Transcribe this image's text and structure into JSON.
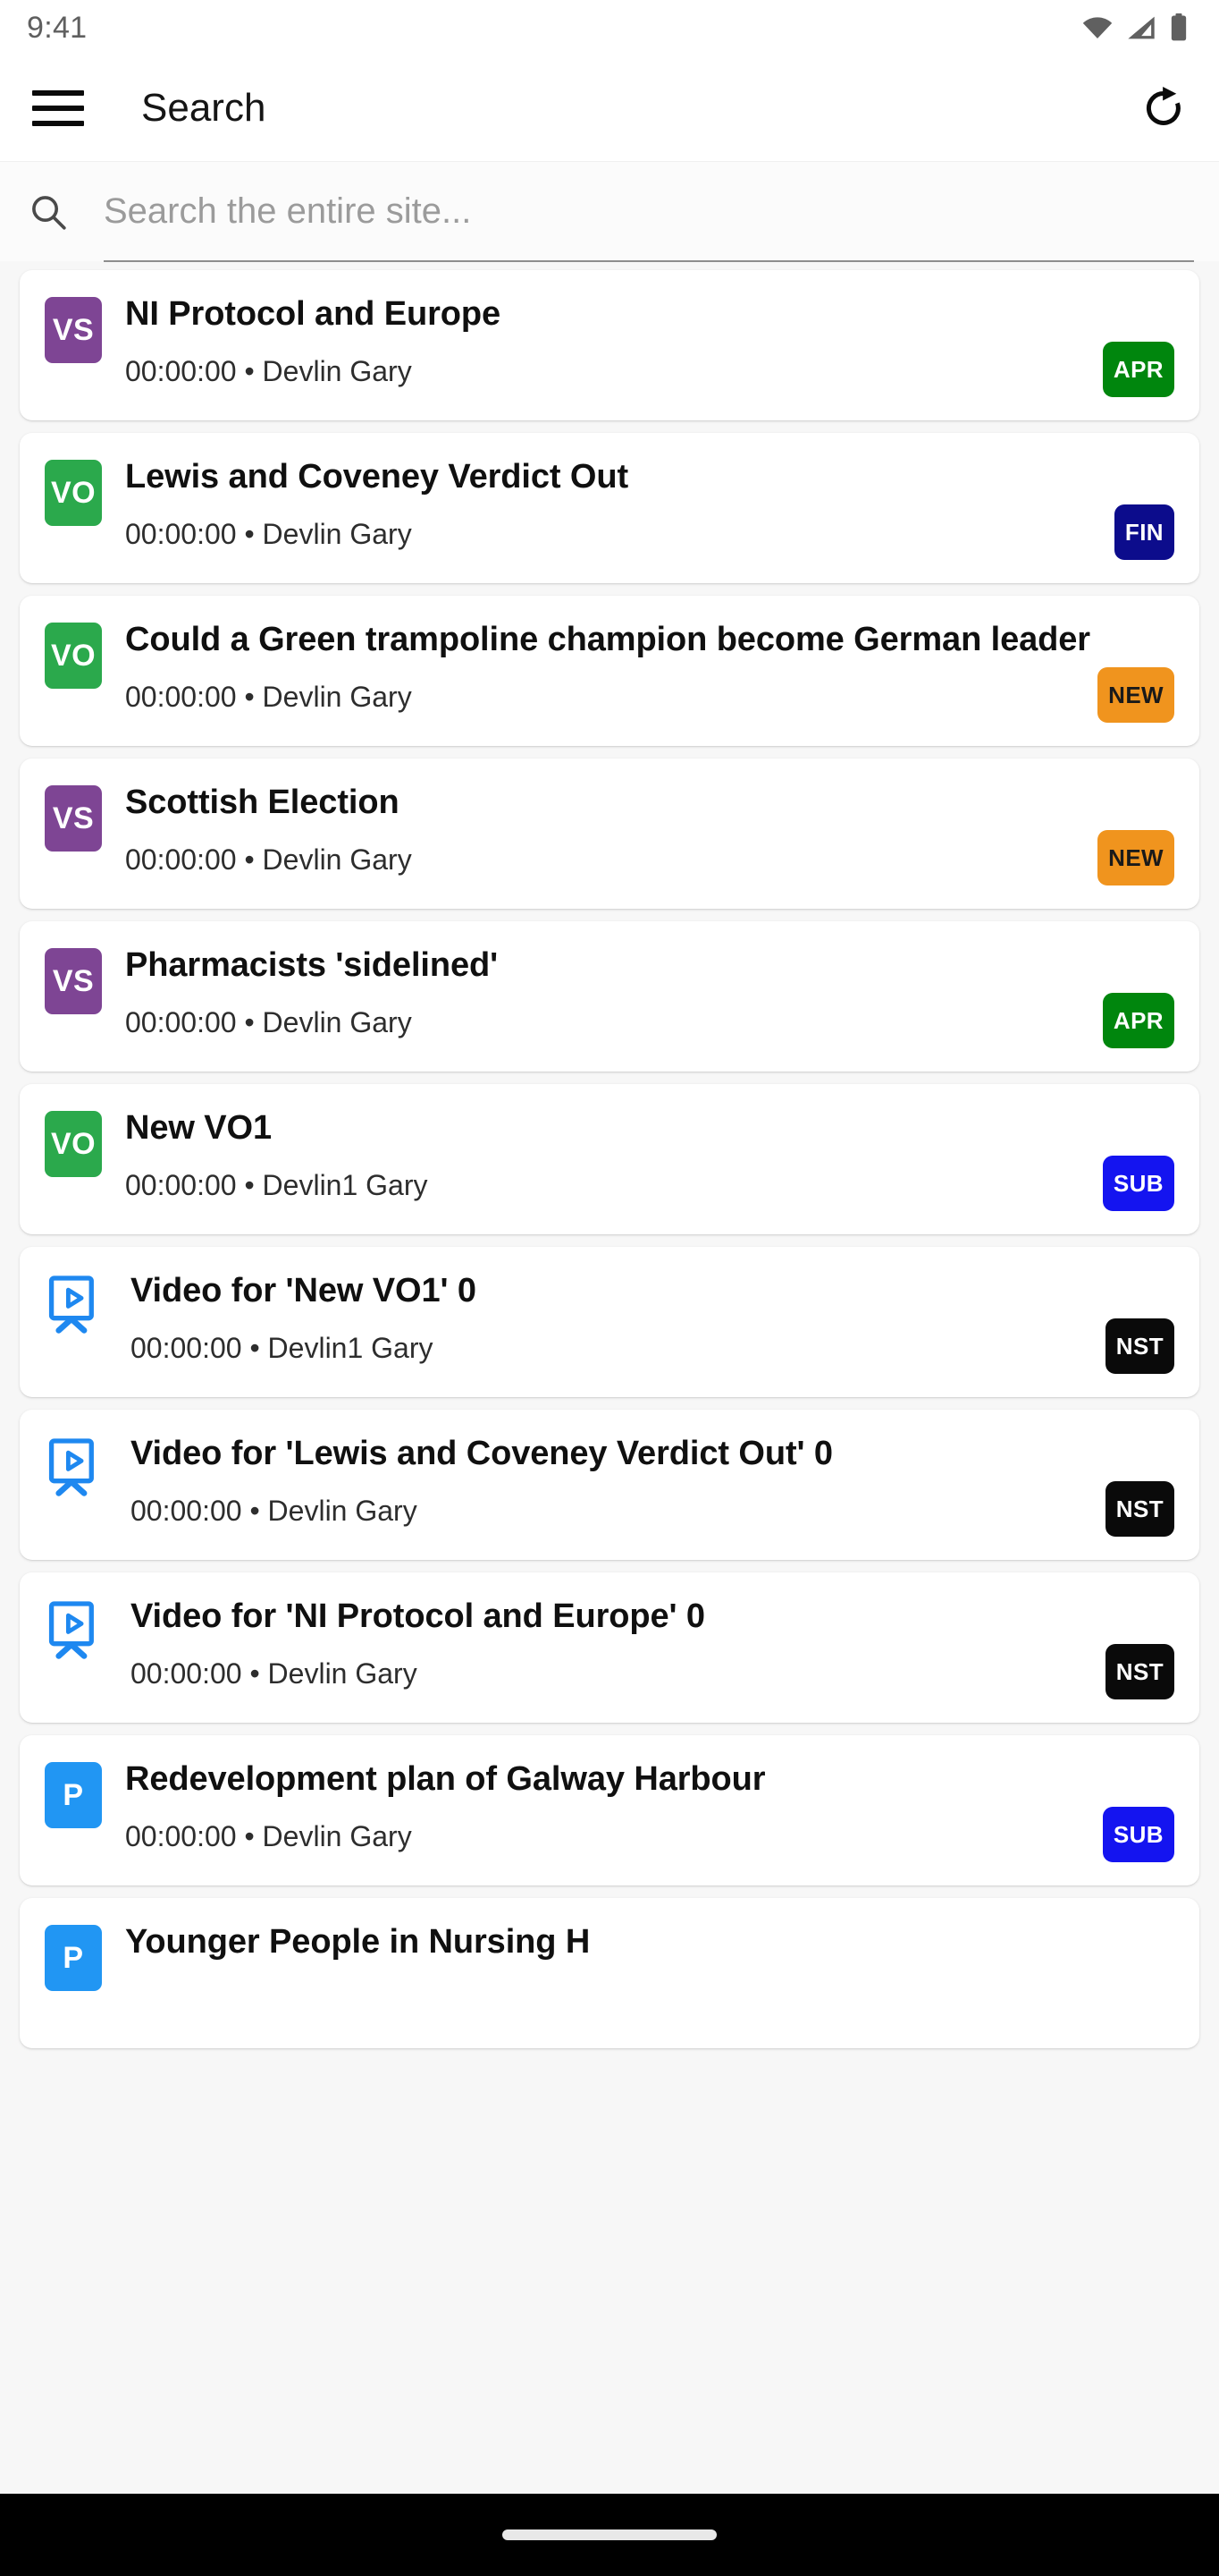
{
  "status_bar": {
    "time": "9:41",
    "icons": [
      "wifi-icon",
      "cellular-signal-icon",
      "battery-icon"
    ]
  },
  "app_bar": {
    "menu_icon": "hamburger-menu-icon",
    "title": "Search",
    "refresh_icon": "refresh-icon"
  },
  "search": {
    "icon": "search-icon",
    "value": "",
    "placeholder": "Search the entire site..."
  },
  "colors": {
    "type_vs": "#7E4594",
    "type_vo": "#2BA94C",
    "type_package": "#2196F3",
    "type_video": "#1E88F0",
    "badge_apr": "#00860D",
    "badge_fin": "#0C0C8C",
    "badge_new": "#F0941E",
    "badge_sub": "#1414F0",
    "badge_nst": "#0A0A0A",
    "badge_new_text": "#1A1A1A",
    "page_background": "#f7f7f7",
    "card_background": "#ffffff"
  },
  "results": [
    {
      "type_icon": "vs-icon",
      "type_label": "VS",
      "type_color": "#7E4594",
      "title": "NI Protocol and Europe",
      "meta": "00:00:00 • Devlin Gary",
      "badge": "APR",
      "badge_color": "#00860D",
      "badge_text_color": "#ffffff"
    },
    {
      "type_icon": "vo-icon",
      "type_label": "VO",
      "type_color": "#2BA94C",
      "title": "Lewis and Coveney Verdict Out",
      "meta": "00:00:00 • Devlin Gary",
      "badge": "FIN",
      "badge_color": "#0C0C8C",
      "badge_text_color": "#ffffff"
    },
    {
      "type_icon": "vo-icon",
      "type_label": "VO",
      "type_color": "#2BA94C",
      "title": "Could a Green trampoline champion become German leader",
      "meta": "00:00:00 • Devlin Gary",
      "badge": "NEW",
      "badge_color": "#F0941E",
      "badge_text_color": "#1A1A1A"
    },
    {
      "type_icon": "vs-icon",
      "type_label": "VS",
      "type_color": "#7E4594",
      "title": "Scottish Election",
      "meta": "00:00:00 • Devlin Gary",
      "badge": "NEW",
      "badge_color": "#F0941E",
      "badge_text_color": "#1A1A1A"
    },
    {
      "type_icon": "vs-icon",
      "type_label": "VS",
      "type_color": "#7E4594",
      "title": "Pharmacists 'sidelined'",
      "meta": "00:00:00 • Devlin Gary",
      "badge": "APR",
      "badge_color": "#00860D",
      "badge_text_color": "#ffffff"
    },
    {
      "type_icon": "vo-icon",
      "type_label": "VO",
      "type_color": "#2BA94C",
      "title": "New VO1",
      "meta": "00:00:00 • Devlin1 Gary",
      "badge": "SUB",
      "badge_color": "#1414F0",
      "badge_text_color": "#ffffff"
    },
    {
      "type_icon": "video-icon",
      "type_label": "",
      "type_color": "#1E88F0",
      "title": "Video for 'New VO1' 0",
      "meta": "00:00:00 • Devlin1 Gary",
      "badge": "NST",
      "badge_color": "#0A0A0A",
      "badge_text_color": "#ffffff"
    },
    {
      "type_icon": "video-icon",
      "type_label": "",
      "type_color": "#1E88F0",
      "title": "Video for 'Lewis and Coveney Verdict Out' 0",
      "meta": "00:00:00 • Devlin Gary",
      "badge": "NST",
      "badge_color": "#0A0A0A",
      "badge_text_color": "#ffffff"
    },
    {
      "type_icon": "video-icon",
      "type_label": "",
      "type_color": "#1E88F0",
      "title": "Video for 'NI Protocol and Europe' 0",
      "meta": "00:00:00 • Devlin Gary",
      "badge": "NST",
      "badge_color": "#0A0A0A",
      "badge_text_color": "#ffffff"
    },
    {
      "type_icon": "package-icon",
      "type_label": "P",
      "type_color": "#2196F3",
      "title": "Redevelopment plan of Galway Harbour",
      "meta": "00:00:00 • Devlin Gary",
      "badge": "SUB",
      "badge_color": "#1414F0",
      "badge_text_color": "#ffffff"
    },
    {
      "type_icon": "package-icon",
      "type_label": "P",
      "type_color": "#2196F3",
      "title": "Younger People in Nursing H",
      "meta": "",
      "badge": "",
      "badge_color": "#1414F0",
      "badge_text_color": "#ffffff"
    }
  ],
  "nav_bar": {
    "home_indicator": "home-indicator"
  }
}
